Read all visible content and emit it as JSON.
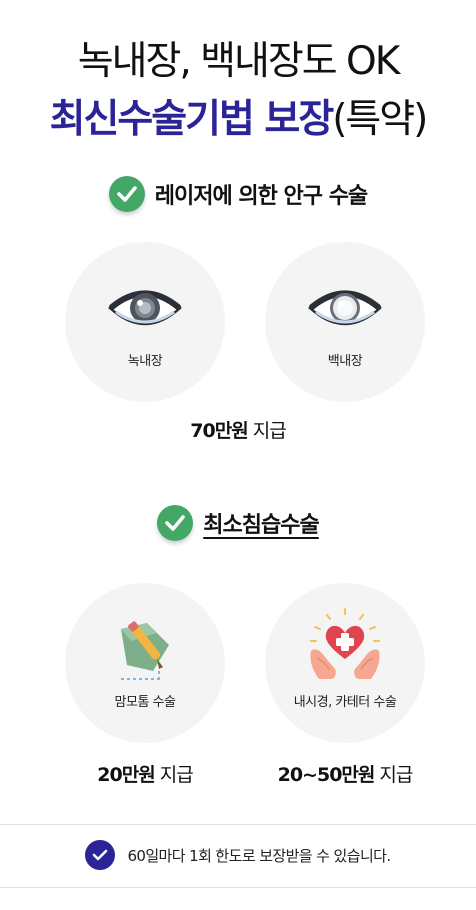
{
  "headline": {
    "line1": "녹내장, 백내장도 OK",
    "line2_accent": "최신수술기법 보장",
    "line2_suffix": "(특약)"
  },
  "laser_section": {
    "title": "레이저에 의한 안구 수술",
    "items": [
      {
        "label": "녹내장",
        "icon": "eye-dark-lens-icon"
      },
      {
        "label": "백내장",
        "icon": "eye-cloudy-lens-icon"
      }
    ],
    "payout_amount": "70만원",
    "payout_suffix": " 지급"
  },
  "minimal_section": {
    "title": "최소침습수술",
    "items": [
      {
        "label": "맘모톰 수술",
        "icon": "surgical-pen-icon",
        "payout_amount": "20만원",
        "payout_suffix": " 지급"
      },
      {
        "label": "내시경, 카테터 수술",
        "icon": "hands-heart-icon",
        "payout_amount": "20~50만원",
        "payout_suffix": " 지급"
      }
    ]
  },
  "footer": {
    "note": "60일마다 1회 한도로 보장받을 수 있습니다."
  },
  "colors": {
    "accent_navy": "#2b2496",
    "check_green": "#43a866",
    "circle_bg": "#f4f4f4",
    "heart_red": "#e0454f"
  }
}
